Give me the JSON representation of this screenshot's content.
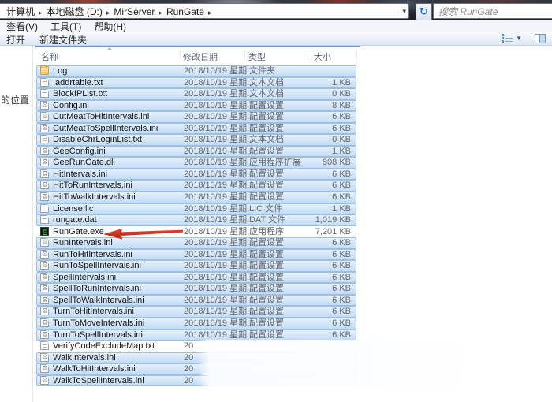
{
  "address": {
    "segments": [
      "计算机",
      "本地磁盘 (D:)",
      "MirServer",
      "RunGate"
    ]
  },
  "search": {
    "placeholder": "搜索 RunGate"
  },
  "menubar": {
    "items": [
      "查看(V)",
      "工具(T)",
      "帮助(H)"
    ]
  },
  "toolbar": {
    "open_label": "打开",
    "new_folder_label": "新建文件夹"
  },
  "sidebar": {
    "fragment": "的位置"
  },
  "list": {
    "columns": [
      "名称",
      "修改日期",
      "类型",
      "大小"
    ],
    "files": [
      {
        "name": "Log",
        "date": "2018/10/19 星期...",
        "type": "文件夹",
        "size": "",
        "icon": "folder",
        "selected": true,
        "blurred": false
      },
      {
        "name": "!addrtable.txt",
        "date": "2018/10/19 星期...",
        "type": "文本文档",
        "size": "1 KB",
        "icon": "txt",
        "selected": true,
        "blurred": false
      },
      {
        "name": "BlockIPList.txt",
        "date": "2018/10/19 星期...",
        "type": "文本文档",
        "size": "0 KB",
        "icon": "txt",
        "selected": true,
        "blurred": false
      },
      {
        "name": "Config.ini",
        "date": "2018/10/19 星期...",
        "type": "配置设置",
        "size": "8 KB",
        "icon": "ini",
        "selected": true,
        "blurred": false
      },
      {
        "name": "CutMeatToHitIntervals.ini",
        "date": "2018/10/19 星期...",
        "type": "配置设置",
        "size": "6 KB",
        "icon": "ini",
        "selected": true,
        "blurred": false
      },
      {
        "name": "CutMeatToSpellIntervals.ini",
        "date": "2018/10/19 星期...",
        "type": "配置设置",
        "size": "6 KB",
        "icon": "ini",
        "selected": true,
        "blurred": false
      },
      {
        "name": "DisableChrLoginList.txt",
        "date": "2018/10/19 星期...",
        "type": "文本文档",
        "size": "0 KB",
        "icon": "txt",
        "selected": true,
        "blurred": false
      },
      {
        "name": "GeeConfig.ini",
        "date": "2018/10/19 星期...",
        "type": "配置设置",
        "size": "1 KB",
        "icon": "ini",
        "selected": true,
        "blurred": false
      },
      {
        "name": "GeeRunGate.dll",
        "date": "2018/10/19 星期...",
        "type": "应用程序扩展",
        "size": "808 KB",
        "icon": "dll",
        "selected": true,
        "blurred": false
      },
      {
        "name": "HitIntervals.ini",
        "date": "2018/10/19 星期...",
        "type": "配置设置",
        "size": "6 KB",
        "icon": "ini",
        "selected": true,
        "blurred": false
      },
      {
        "name": "HitToRunIntervals.ini",
        "date": "2018/10/19 星期...",
        "type": "配置设置",
        "size": "6 KB",
        "icon": "ini",
        "selected": true,
        "blurred": false
      },
      {
        "name": "HitToWalkIntervals.ini",
        "date": "2018/10/19 星期...",
        "type": "配置设置",
        "size": "6 KB",
        "icon": "ini",
        "selected": true,
        "blurred": false
      },
      {
        "name": "License.lic",
        "date": "2018/10/19 星期...",
        "type": "LIC 文件",
        "size": "1 KB",
        "icon": "lic",
        "selected": true,
        "blurred": false
      },
      {
        "name": "rungate.dat",
        "date": "2018/10/19 星期...",
        "type": "DAT 文件",
        "size": "1,019 KB",
        "icon": "dat",
        "selected": true,
        "blurred": false
      },
      {
        "name": "RunGate.exe",
        "date": "2018/10/19 星期...",
        "type": "应用程序",
        "size": "7,201 KB",
        "icon": "exe",
        "selected": false,
        "blurred": false
      },
      {
        "name": "RunIntervals.ini",
        "date": "2018/10/19 星期...",
        "type": "配置设置",
        "size": "6 KB",
        "icon": "ini",
        "selected": true,
        "blurred": false
      },
      {
        "name": "RunToHitIntervals.ini",
        "date": "2018/10/19 星期...",
        "type": "配置设置",
        "size": "6 KB",
        "icon": "ini",
        "selected": true,
        "blurred": false
      },
      {
        "name": "RunToSpellIntervals.ini",
        "date": "2018/10/19 星期...",
        "type": "配置设置",
        "size": "6 KB",
        "icon": "ini",
        "selected": true,
        "blurred": false
      },
      {
        "name": "SpellIntervals.ini",
        "date": "2018/10/19 星期...",
        "type": "配置设置",
        "size": "6 KB",
        "icon": "ini",
        "selected": true,
        "blurred": false
      },
      {
        "name": "SpellToRunIntervals.ini",
        "date": "2018/10/19 星期...",
        "type": "配置设置",
        "size": "6 KB",
        "icon": "ini",
        "selected": true,
        "blurred": false
      },
      {
        "name": "SpellToWalkIntervals.ini",
        "date": "2018/10/19 星期...",
        "type": "配置设置",
        "size": "6 KB",
        "icon": "ini",
        "selected": true,
        "blurred": false
      },
      {
        "name": "TurnToHitIntervals.ini",
        "date": "2018/10/19 星期...",
        "type": "配置设置",
        "size": "6 KB",
        "icon": "ini",
        "selected": true,
        "blurred": false
      },
      {
        "name": "TurnToMoveIntervals.ini",
        "date": "2018/10/19 星期...",
        "type": "配置设置",
        "size": "6 KB",
        "icon": "ini",
        "selected": true,
        "blurred": false
      },
      {
        "name": "TurnToSpellIntervals.ini",
        "date": "2018/10/19 星期...",
        "type": "配置设置",
        "size": "6 KB",
        "icon": "ini",
        "selected": true,
        "blurred": false
      },
      {
        "name": "VerifyCodeExcludeMap.txt",
        "date": "20",
        "type": "",
        "size": "",
        "icon": "txt",
        "selected": false,
        "blurred": true
      },
      {
        "name": "WalkIntervals.ini",
        "date": "20",
        "type": "",
        "size": "",
        "icon": "ini",
        "selected": true,
        "blurred": true
      },
      {
        "name": "WalkToHitIntervals.ini",
        "date": "20",
        "type": "",
        "size": "",
        "icon": "ini",
        "selected": true,
        "blurred": true
      },
      {
        "name": "WalkToSpellIntervals.ini",
        "date": "20",
        "type": "",
        "size": "",
        "icon": "ini",
        "selected": true,
        "blurred": true
      }
    ]
  },
  "annotation": {
    "shape": "red-arrow",
    "points_at": "RunGate.exe",
    "color": "#cf2f1a"
  },
  "colors": {
    "selection_top": "#e4f0fd",
    "selection_bottom": "#c3dcf6",
    "selection_border": "#9cbfe2",
    "exe_icon_green": "#3fd14a",
    "header_text": "#5c6b7a"
  }
}
